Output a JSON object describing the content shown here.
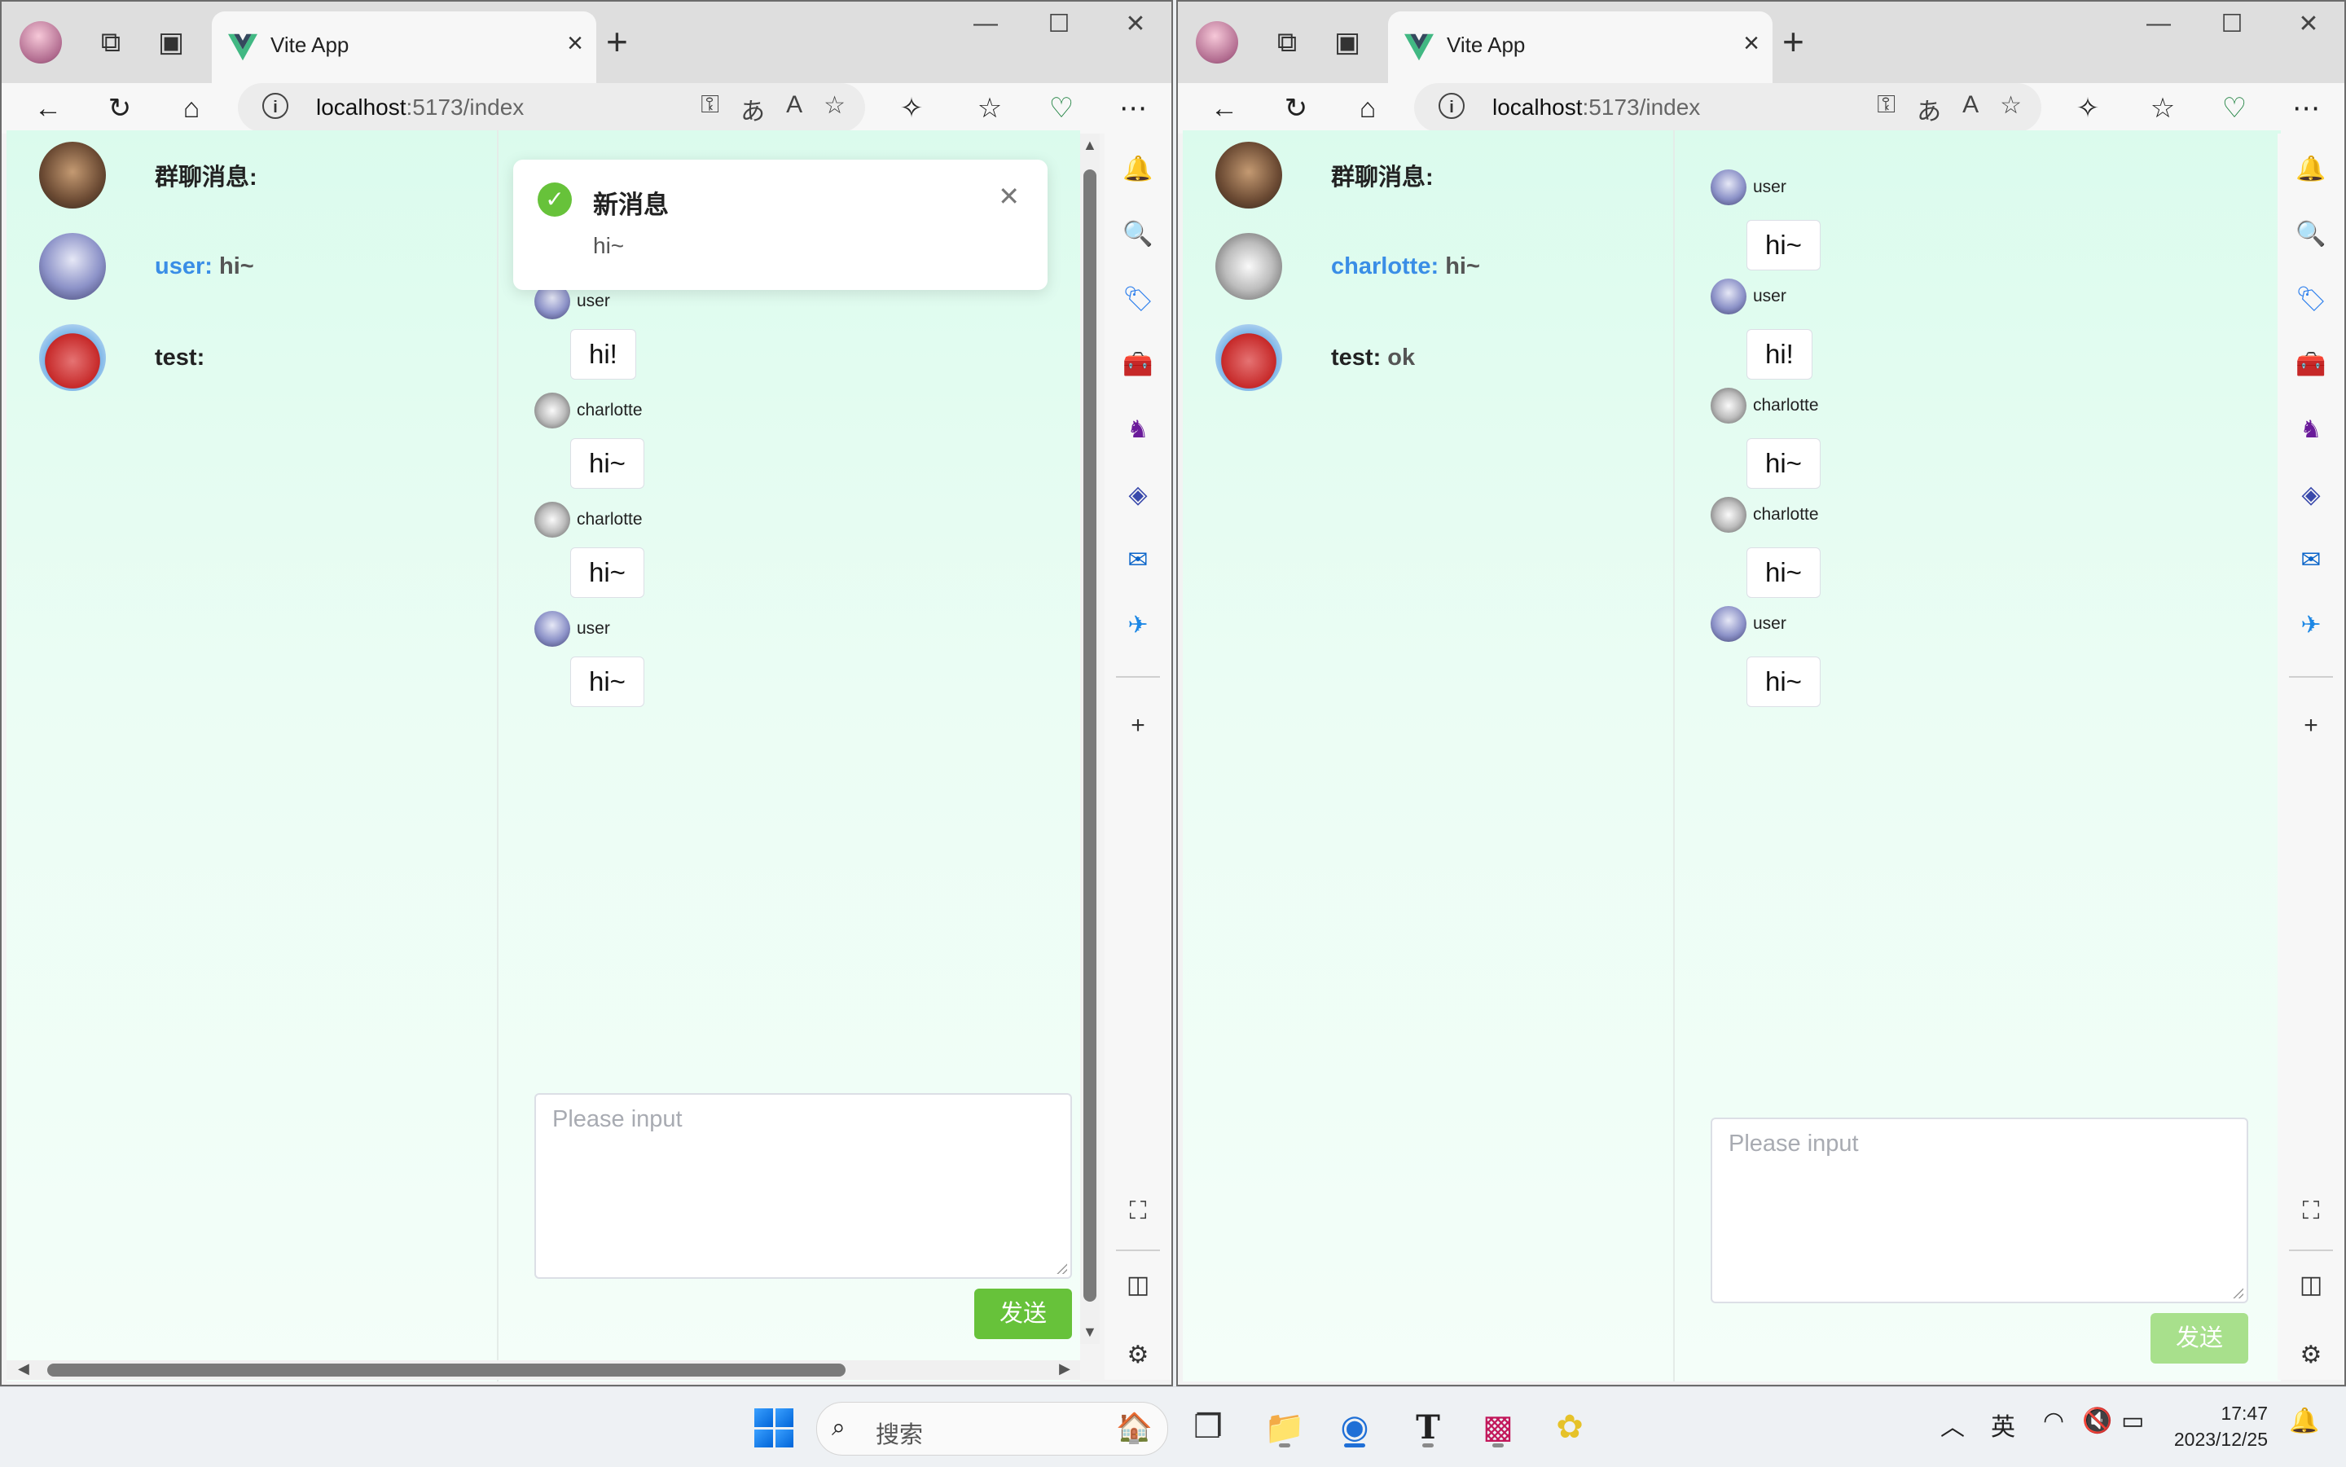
{
  "windows": [
    {
      "tab_title": "Vite App",
      "address_host": "localhost",
      "address_path": ":5173/index",
      "conversations": [
        {
          "name": "群聊消息:",
          "message": "",
          "highlight": false
        },
        {
          "name": "user:",
          "message": "hi~",
          "highlight": true
        },
        {
          "name": "test:",
          "message": "",
          "highlight": false
        }
      ],
      "messages": [
        {
          "sender": "user",
          "text": "hi!"
        },
        {
          "sender": "charlotte",
          "text": "hi~"
        },
        {
          "sender": "charlotte",
          "text": "hi~"
        },
        {
          "sender": "user",
          "text": "hi~"
        }
      ],
      "input_placeholder": "Please input",
      "send_label": "发送",
      "toast": {
        "title": "新消息",
        "body": "hi~"
      }
    },
    {
      "tab_title": "Vite App",
      "address_host": "localhost",
      "address_path": ":5173/index",
      "conversations": [
        {
          "name": "群聊消息:",
          "message": "",
          "highlight": false
        },
        {
          "name": "charlotte:",
          "message": "hi~",
          "highlight": true
        },
        {
          "name": "test:",
          "message": "ok",
          "highlight": false
        }
      ],
      "messages": [
        {
          "sender": "user",
          "text": "hi~"
        },
        {
          "sender": "user",
          "text": "hi!"
        },
        {
          "sender": "charlotte",
          "text": "hi~"
        },
        {
          "sender": "charlotte",
          "text": "hi~"
        },
        {
          "sender": "user",
          "text": "hi~"
        }
      ],
      "input_placeholder": "Please input",
      "send_label": "发送"
    }
  ],
  "taskbar": {
    "search_label": "搜索",
    "ime_label": "英",
    "time": "17:47",
    "date": "2023/12/25"
  },
  "colors": {
    "accent_green": "#67c23a",
    "name_blue": "#3a8ee6",
    "chat_background": "#dbfbed"
  }
}
